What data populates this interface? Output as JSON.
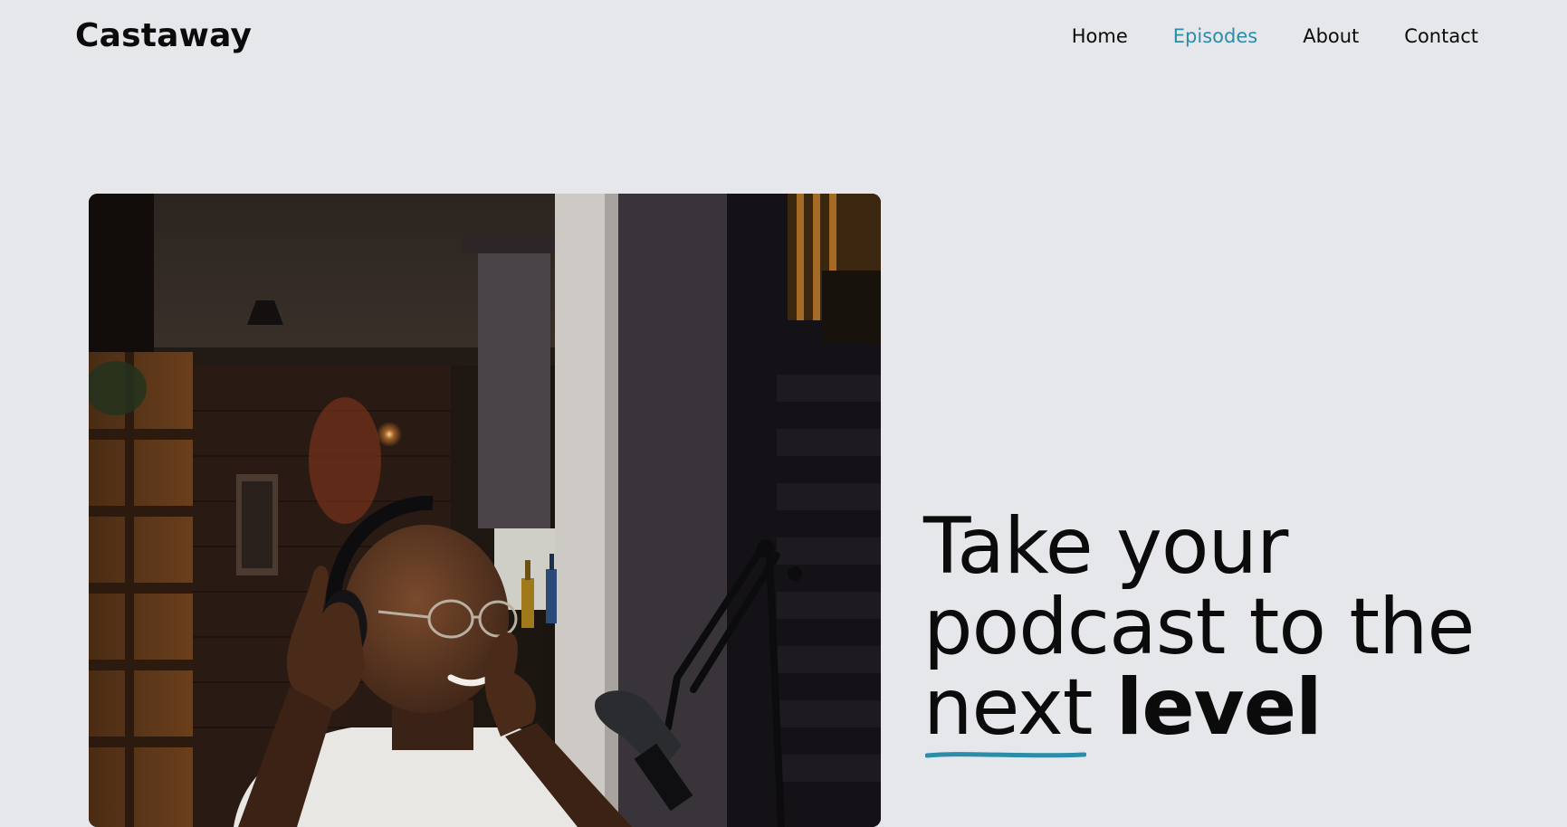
{
  "brand": {
    "name": "Castaway"
  },
  "nav": {
    "items": [
      {
        "label": "Home",
        "active": false
      },
      {
        "label": "Episodes",
        "active": true
      },
      {
        "label": "About",
        "active": false
      },
      {
        "label": "Contact",
        "active": false
      }
    ]
  },
  "hero": {
    "heading_line1": "Take your",
    "heading_line2": "podcast to the",
    "heading_line3_plain": "next",
    "heading_line3_bold": "level",
    "accent_color": "#2b8da7"
  },
  "colors": {
    "background": "#e6e7eb",
    "text": "#0b0b0b",
    "accent": "#2b8da7"
  }
}
